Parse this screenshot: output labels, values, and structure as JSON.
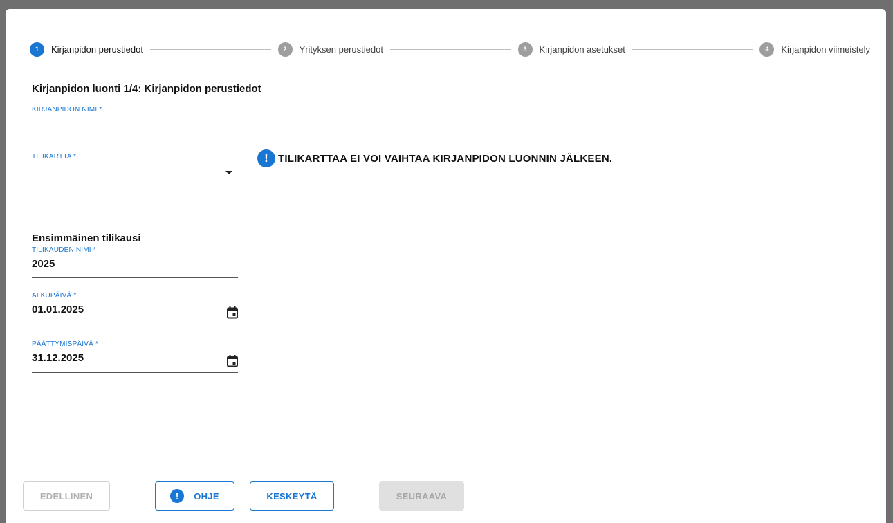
{
  "stepper": {
    "steps": [
      {
        "number": "1",
        "label": "Kirjanpidon perustiedot"
      },
      {
        "number": "2",
        "label": "Yrityksen perustiedot"
      },
      {
        "number": "3",
        "label": "Kirjanpidon asetukset"
      },
      {
        "number": "4",
        "label": "Kirjanpidon viimeistely"
      }
    ],
    "active_step": 1
  },
  "heading": "Kirjanpidon luonti 1/4: Kirjanpidon perustiedot",
  "fields": {
    "name": {
      "label": "KIRJANPIDON NIMI *",
      "value": ""
    },
    "chart": {
      "label": "TILIKARTTA *",
      "value": ""
    }
  },
  "warning": {
    "icon": "exclamation-icon",
    "text": "TILIKARTTAA EI VOI VAIHTAA KIRJANPIDON LUONNIN JÄLKEEN."
  },
  "period": {
    "heading": "Ensimmäinen tilikausi",
    "name": {
      "label": "TILIKAUDEN NIMI *",
      "value": "2025"
    },
    "start": {
      "label": "ALKUPÄIVÄ *",
      "value": "01.01.2025"
    },
    "end": {
      "label": "PÄÄTTYMISPÄIVÄ *",
      "value": "31.12.2025"
    }
  },
  "buttons": {
    "previous": "EDELLINEN",
    "help": "OHJE",
    "cancel": "KESKEYTÄ",
    "next": "SEURAAVA"
  },
  "colors": {
    "accent": "#1976d2",
    "inactive_step": "#9e9e9e",
    "disabled": "#e0e0e0"
  }
}
